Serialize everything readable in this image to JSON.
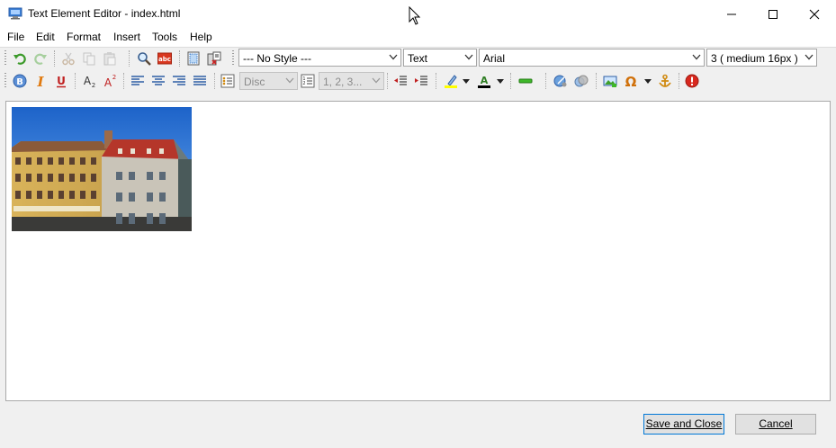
{
  "window": {
    "title": "Text Element Editor - index.html"
  },
  "menu": [
    "File",
    "Edit",
    "Format",
    "Insert",
    "Tools",
    "Help"
  ],
  "toolbar": {
    "style_select": "--- No Style ---",
    "block_select": "Text",
    "font_select": "Arial",
    "size_select": "3 ( medium 16px )",
    "bullet_select": "Disc",
    "number_select": "1, 2, 3..."
  },
  "buttons": {
    "save": "Save and Close",
    "cancel": "Cancel"
  },
  "colors": {
    "accent": "#0078d7",
    "highlight": "#ffff00",
    "font_color": "#000000"
  }
}
